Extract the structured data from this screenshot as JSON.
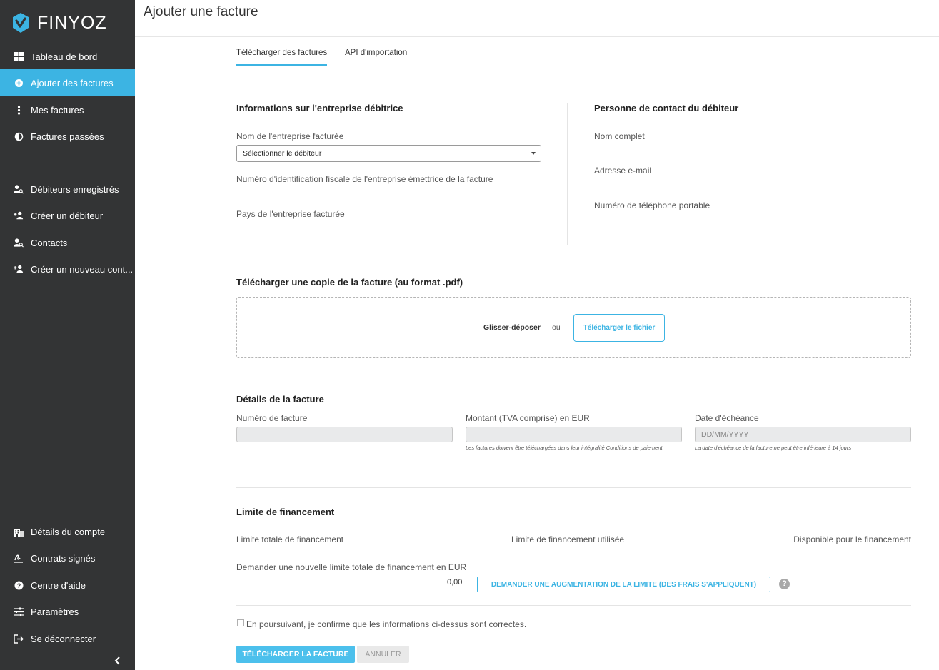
{
  "app": {
    "name": "FINYOZ"
  },
  "sidebar": {
    "items": [
      {
        "label": "Tableau de bord",
        "icon": "dashboard-icon"
      },
      {
        "label": "Ajouter des factures",
        "icon": "add-circle-icon",
        "active": true
      },
      {
        "label": "Mes factures",
        "icon": "vertical-dots-icon"
      },
      {
        "label": "Factures passées",
        "icon": "half-circle-icon"
      },
      {
        "label": "Débiteurs enregistrés",
        "icon": "user-search-icon"
      },
      {
        "label": "Créer un débiteur",
        "icon": "user-add-icon"
      },
      {
        "label": "Contacts",
        "icon": "user-search-icon"
      },
      {
        "label": "Créer un nouveau cont...",
        "icon": "user-add-icon"
      },
      {
        "label": "Détails du compte",
        "icon": "building-icon"
      },
      {
        "label": "Contrats signés",
        "icon": "signature-icon"
      },
      {
        "label": "Centre d'aide",
        "icon": "help-circle-icon"
      },
      {
        "label": "Paramètres",
        "icon": "sliders-icon"
      },
      {
        "label": "Se déconnecter",
        "icon": "logout-icon"
      }
    ]
  },
  "header": {
    "title": "Ajouter une facture"
  },
  "tabs": [
    {
      "label": "Télécharger des factures",
      "active": true
    },
    {
      "label": "API d'importation",
      "active": false
    }
  ],
  "debtor": {
    "title": "Informations sur l'entreprise débitrice",
    "company_label": "Nom de l'entreprise facturée",
    "company_select": "Sélectionner le débiteur",
    "tax_label": "Numéro d'identification fiscale de l'entreprise émettrice de la facture",
    "country_label": "Pays de l'entreprise facturée"
  },
  "contact": {
    "title": "Personne de contact du débiteur",
    "name_label": "Nom complet",
    "email_label": "Adresse e-mail",
    "phone_label": "Numéro de téléphone portable"
  },
  "upload": {
    "title": "Télécharger une copie de la facture (au format .pdf)",
    "drag_text": "Glisser-déposer",
    "or_text": "ou",
    "button": "Télécharger le fichier"
  },
  "invoice": {
    "title": "Détails de la facture",
    "number_label": "Numéro de facture",
    "number_value": "",
    "amount_label": "Montant (TVA comprise) en EUR",
    "amount_value": "",
    "amount_hint": "Les factures doivent être téléchargées dans leur intégralité Conditions de paiement",
    "due_label": "Date d'échéance",
    "due_placeholder": "DD/MM/YYYY",
    "due_hint": "La date d'échéance de la facture ne peut être inférieure à 14 jours"
  },
  "financing": {
    "title": "Limite de financement",
    "total_label": "Limite totale de financement",
    "used_label": "Limite de financement utilisée",
    "available_label": "Disponible pour le financement",
    "request_label": "Demander une nouvelle limite totale de financement en EUR",
    "amount": "0,00",
    "request_button": "DEMANDER UNE AUGMENTATION DE LA LIMITE (DES FRAIS S'APPLIQUENT)",
    "help": "?"
  },
  "confirm": {
    "label": "En poursuivant, je confirme que les informations ci-dessus sont correctes."
  },
  "actions": {
    "submit": "TÉLÉCHARGER LA FACTURE",
    "cancel": "ANNULER"
  },
  "colors": {
    "accent": "#3cb4e3",
    "sidebar": "#333435"
  }
}
